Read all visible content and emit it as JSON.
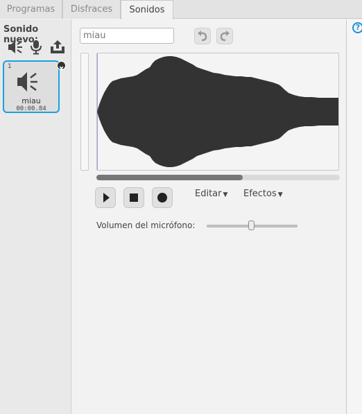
{
  "tabs": [
    {
      "label": "Programas"
    },
    {
      "label": "Disfraces"
    },
    {
      "label": "Sonidos"
    }
  ],
  "active_tab": "Sonidos",
  "new_sound": {
    "label": "Sonido nuevo:",
    "icons": [
      "speaker-library-icon",
      "microphone-icon",
      "upload-icon"
    ]
  },
  "sound_list": [
    {
      "index": "1",
      "name": "miau",
      "duration": "00:00.84",
      "selected": true
    }
  ],
  "editor": {
    "sound_name": "miau",
    "buttons": {
      "undo_icon": "undo-icon",
      "redo_icon": "redo-icon"
    },
    "controls": [
      "play-icon",
      "stop-icon",
      "record-icon"
    ],
    "menus": {
      "edit": "Editar",
      "effects": "Efectos"
    },
    "mic_label": "Volumen del micrófono:",
    "mic_level": 0.5
  },
  "help": {
    "symbol": "?"
  },
  "colors": {
    "accent": "#1aa0e0",
    "waveform": "#333333"
  }
}
